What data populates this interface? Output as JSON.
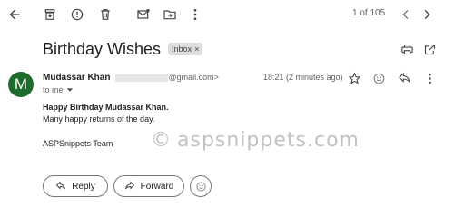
{
  "toolbar": {
    "icons": [
      "back-arrow-icon",
      "archive-icon",
      "report-spam-icon",
      "delete-icon",
      "mark-unread-icon",
      "move-to-icon",
      "more-vert-icon",
      "newer-icon",
      "older-icon"
    ],
    "pager_text": "1 of 105"
  },
  "message": {
    "subject": "Birthday Wishes",
    "label": "Inbox",
    "label_close": "×",
    "sender_name": "Mudassar Khan",
    "sender_email_visible": "@gmail.com>",
    "recipient": "to me",
    "timestamp": "18:21 (2 minutes ago)",
    "avatar_letter": "M",
    "avatar_color": "#1e6b2e",
    "body": {
      "line1": "Happy Birthday Mudassar Khan.",
      "line2": "Many happy returns of the day.",
      "signature": "ASPSnippets Team"
    }
  },
  "watermark": {
    "symbol": "©",
    "text": "aspsnippets.com"
  },
  "actions": {
    "reply_label": "Reply",
    "forward_label": "Forward"
  }
}
